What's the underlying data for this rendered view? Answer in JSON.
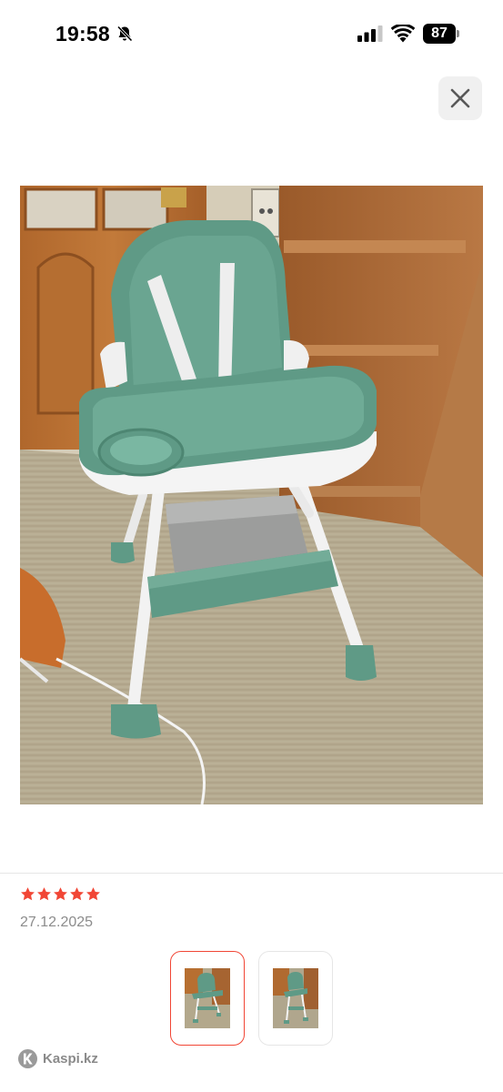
{
  "status_bar": {
    "time": "19:58",
    "battery": "87",
    "icons": [
      "bell-off-icon",
      "cellular-signal-icon",
      "wifi-icon",
      "battery-icon"
    ]
  },
  "viewer": {
    "close_icon": "close-icon",
    "main_image_alt": "",
    "selected_thumbnail_index": 0
  },
  "review": {
    "rating": 5,
    "rating_max": 5,
    "star_color": "#f14635",
    "date": "27.12.2025"
  },
  "thumbnails": [
    {
      "selected": true
    },
    {
      "selected": false
    }
  ],
  "footer": {
    "brand": "Kaspi.kz",
    "logo_icon": "kaspi-logo-icon"
  },
  "colors": {
    "accent": "#f14635",
    "chair_green": "#5f9a86",
    "muted_text": "#8c8c8c"
  }
}
